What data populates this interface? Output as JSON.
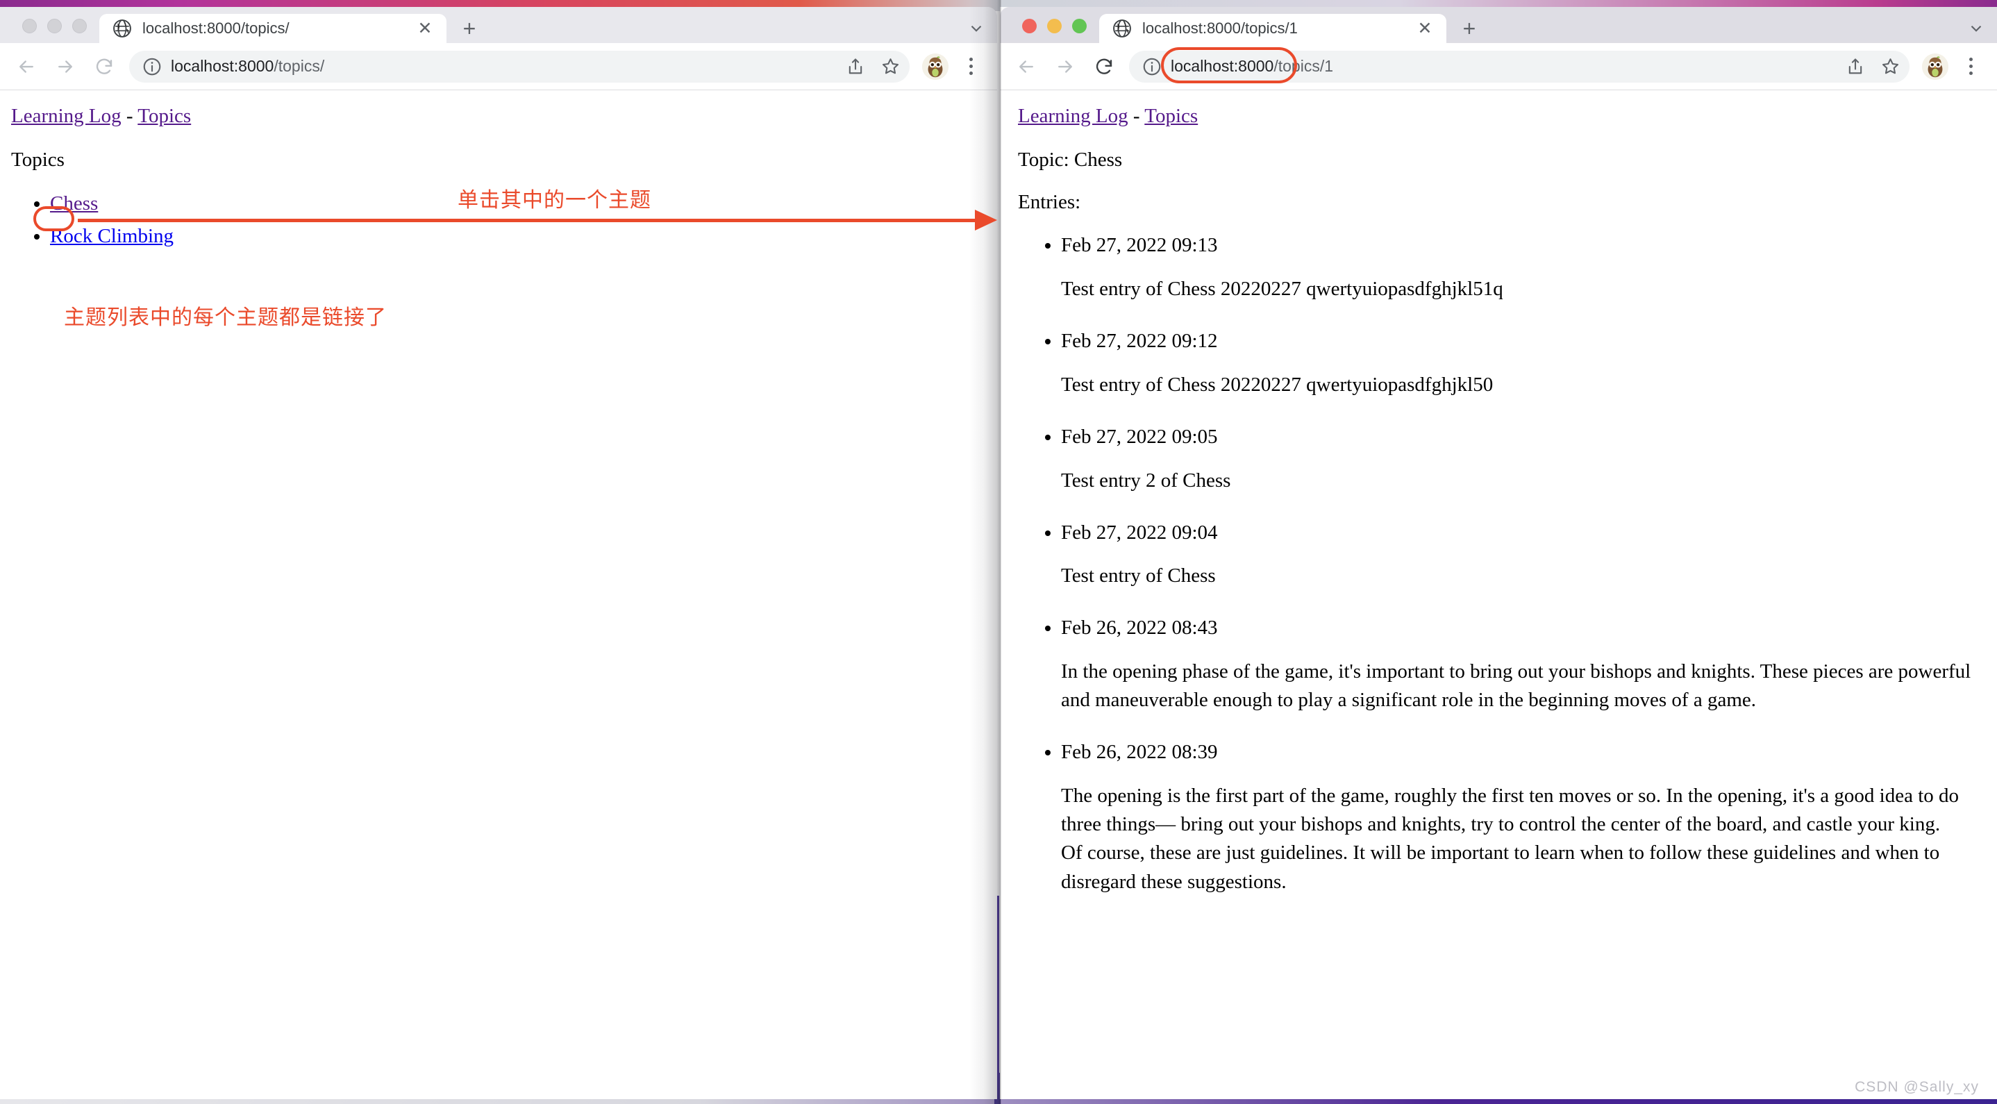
{
  "desktop": {
    "watermark": "CSDN @Sally_xy"
  },
  "windows": [
    {
      "id": "left",
      "traffic_lights": [
        "inactive",
        "inactive",
        "inactive"
      ],
      "tab": {
        "title": "localhost:8000/topics/",
        "favicon": "globe-icon",
        "close_label": "✕",
        "new_tab_label": "+"
      },
      "toolbar": {
        "back_label": "back-arrow",
        "forward_label": "forward-arrow",
        "reload_label": "reload",
        "info_label": "site-info",
        "url_bold": "localhost:8000",
        "url_rest": "/topics/",
        "url_full": "localhost:8000/topics/",
        "share_label": "share-icon",
        "bookmark_label": "star-icon",
        "profile_label": "owl-avatar",
        "menu_label": "three-dot-menu"
      },
      "page": {
        "breadcrumb": {
          "home": "Learning Log",
          "separator": " - ",
          "current": "Topics"
        },
        "heading": "Topics",
        "topics": [
          {
            "label": "Chess",
            "state": "visited"
          },
          {
            "label": "Rock Climbing",
            "state": "unvisited"
          }
        ]
      }
    },
    {
      "id": "right",
      "traffic_lights": [
        "red",
        "yellow",
        "green"
      ],
      "tab": {
        "title": "localhost:8000/topics/1",
        "favicon": "globe-icon",
        "close_label": "✕",
        "new_tab_label": "+"
      },
      "toolbar": {
        "back_label": "back-arrow",
        "forward_label": "forward-arrow",
        "reload_label": "reload",
        "info_label": "site-info",
        "url_bold": "localhost:8000",
        "url_rest": "/topics/1",
        "url_full": "localhost:8000/topics/1",
        "share_label": "share-icon",
        "bookmark_label": "star-icon",
        "profile_label": "owl-avatar",
        "menu_label": "three-dot-menu"
      },
      "page": {
        "breadcrumb": {
          "home": "Learning Log",
          "separator": " - ",
          "current": "Topics"
        },
        "topic_line": "Topic: Chess",
        "entries_label": "Entries:",
        "entries": [
          {
            "date": "Feb 27, 2022 09:13",
            "text": "Test entry of Chess 20220227 qwertyuiopasdfghjkl51q"
          },
          {
            "date": "Feb 27, 2022 09:12",
            "text": "Test entry of Chess 20220227 qwertyuiopasdfghjkl50"
          },
          {
            "date": "Feb 27, 2022 09:05",
            "text": "Test entry 2 of Chess"
          },
          {
            "date": "Feb 27, 2022 09:04",
            "text": "Test entry of Chess"
          },
          {
            "date": "Feb 26, 2022 08:43",
            "text": "In the opening phase of the game, it's important to bring out your bishops and knights. These pieces are powerful and maneuverable enough to play a significant role in the beginning moves of a game."
          },
          {
            "date": "Feb 26, 2022 08:39",
            "text": "The opening is the first part of the game, roughly the first ten moves or so. In the opening, it's a good idea to do three things— bring out your bishops and knights, try to control the center of the board, and castle your king.\nOf course, these are just guidelines. It will be important to learn when to follow these guidelines and when to disregard these suggestions."
          }
        ]
      }
    }
  ],
  "annotations": {
    "click_topic": "单击其中的一个主题",
    "topics_are_links": "主题列表中的每个主题都是链接了"
  },
  "colors": {
    "annotation_red": "#ea4a2b",
    "link_visited": "#551a8b",
    "link_unvisited": "#0000ee"
  }
}
